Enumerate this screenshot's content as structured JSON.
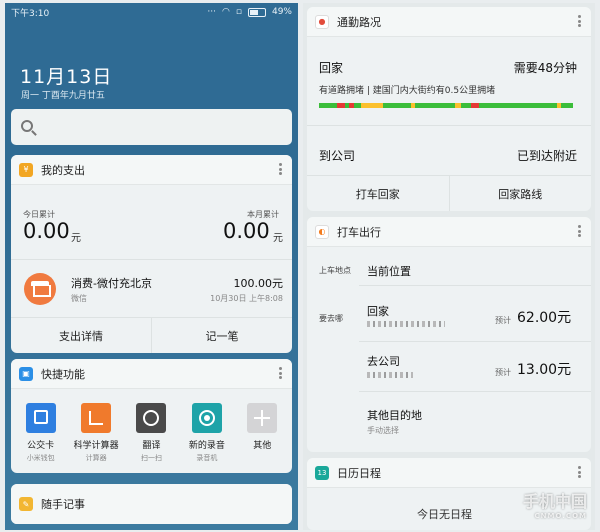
{
  "status": {
    "time": "下午3:10",
    "battery": "49%"
  },
  "lockscreen": {
    "date": "11月13日",
    "subdate": "周一 丁酉年九月廿五"
  },
  "spending": {
    "title": "我的支出",
    "today_label": "今日累计",
    "today_amount": "0.00",
    "month_label": "本月累计",
    "month_amount": "0.00",
    "unit": "元",
    "tx": {
      "title": "消费-微付充北京",
      "source": "微信",
      "amount": "100.00元",
      "time": "10月30日 上午8:08"
    },
    "buttons": [
      "支出详情",
      "记一笔"
    ]
  },
  "quick": {
    "title": "快捷功能",
    "items": [
      {
        "name": "公交卡",
        "sub": "小米钱包",
        "color": "#2e7fe0"
      },
      {
        "name": "科学计算器",
        "sub": "计算器",
        "color": "#f07a2c"
      },
      {
        "name": "翻译",
        "sub": "扫一扫",
        "color": "#4a4a4a"
      },
      {
        "name": "新的录音",
        "sub": "录音机",
        "color": "#1ea3a8"
      },
      {
        "name": "其他",
        "sub": "",
        "color": "#d4d4d6"
      }
    ]
  },
  "memo": {
    "title": "随手记事"
  },
  "commute": {
    "title": "通勤路况",
    "home": "回家",
    "home_eta": "需要48分钟",
    "congestion": "有道路拥堵 | 建国门内大街约有0.5公里拥堵",
    "work": "到公司",
    "work_status": "已到达附近",
    "buttons": [
      "打车回家",
      "回家路线"
    ]
  },
  "taxi": {
    "title": "打车出行",
    "pickup_label": "上车地点",
    "pickup_value": "当前位置",
    "dest_label": "要去哪",
    "estimate_label": "预计",
    "destinations": [
      {
        "name": "回家",
        "price": "62.00元"
      },
      {
        "name": "去公司",
        "price": "13.00元"
      }
    ],
    "other": "其他目的地",
    "other_sub": "手动选择"
  },
  "calendar": {
    "title": "日历日程",
    "badge": "13",
    "empty": "今日无日程"
  },
  "watermark": {
    "main": "手机中国",
    "sub": "CNMO.COM"
  }
}
